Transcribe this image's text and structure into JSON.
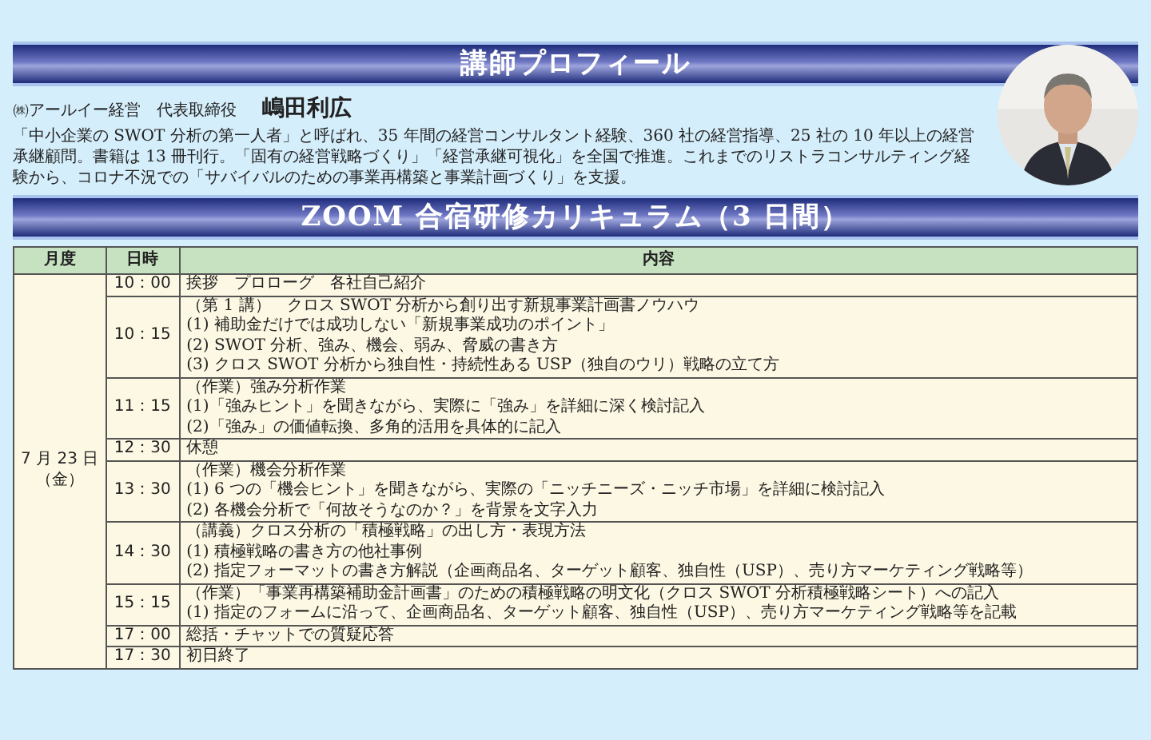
{
  "profile_banner": {
    "title": "講師プロフィール"
  },
  "instructor": {
    "affiliation": "㈱アールイー経営　代表取締役",
    "name": "嶋田利広",
    "bio": "「中小企業の SWOT 分析の第一人者」と呼ばれ、35 年間の経営コンサルタント経験、360 社の経営指導、25 社の 10 年以上の経営承継顧問。書籍は 13 冊刊行。「固有の経営戦略づくり」「経営承継可視化」を全国で推進。これまでのリストラコンサルティング経験から、コロナ不況での「サバイバルのための事業再構築と事業計画づくり」を支援。"
  },
  "curriculum_banner": {
    "title": "ZOOM 合宿研修カリキュラム（3 日間）"
  },
  "table": {
    "columns": [
      "月度",
      "日時",
      "内容"
    ],
    "day": {
      "date": "7 月 23 日",
      "weekday": "（金）"
    },
    "rows": [
      {
        "time": "10：00",
        "lines": [
          "挨拶　プロローグ　各社自己紹介"
        ]
      },
      {
        "time": "10：15",
        "lines": [
          "（第 1 講）　クロス SWOT 分析から創り出す新規事業計画書ノウハウ",
          "(1)  補助金だけでは成功しない「新規事業成功のポイント」",
          "(2)  SWOT 分析、強み、機会、弱み、脅威の書き方",
          "(3)  クロス SWOT 分析から独自性・持続性ある USP（独自のウリ）戦略の立て方"
        ]
      },
      {
        "time": "11：15",
        "lines": [
          "（作業）強み分析作業",
          "(1)「強みヒント」を聞きながら、実際に「強み」を詳細に深く検討記入",
          "(2)「強み」の価値転換、多角的活用を具体的に記入"
        ]
      },
      {
        "time": "12：30",
        "lines": [
          "休憩"
        ]
      },
      {
        "time": "13：30",
        "lines": [
          "（作業）機会分析作業",
          "(1)  6 つの「機会ヒント」を聞きながら、実際の「ニッチニーズ・ニッチ市場」を詳細に検討記入",
          "(2)  各機会分析で「何故そうなのか？」を背景を文字入力"
        ]
      },
      {
        "time": "14：30",
        "lines": [
          "（講義）クロス分析の「積極戦略」の出し方・表現方法",
          "(1)  積極戦略の書き方の他社事例",
          "(2)  指定フォーマットの書き方解説（企画商品名、ターゲット顧客、独自性（USP）、売り方マーケティング戦略等）"
        ]
      },
      {
        "time": "15：15",
        "lines": [
          "（作業）「事業再構築補助金計画書」のための積極戦略の明文化（クロス SWOT 分析積極戦略シート）への記入",
          "(1)  指定のフォームに沿って、企画商品名、ターゲット顧客、独自性（USP）、売り方マーケティング戦略等を記載"
        ]
      },
      {
        "time": "17：00",
        "lines": [
          "総括・チャットでの質疑応答"
        ]
      },
      {
        "time": "17：30",
        "lines": [
          "初日終了"
        ]
      }
    ]
  }
}
